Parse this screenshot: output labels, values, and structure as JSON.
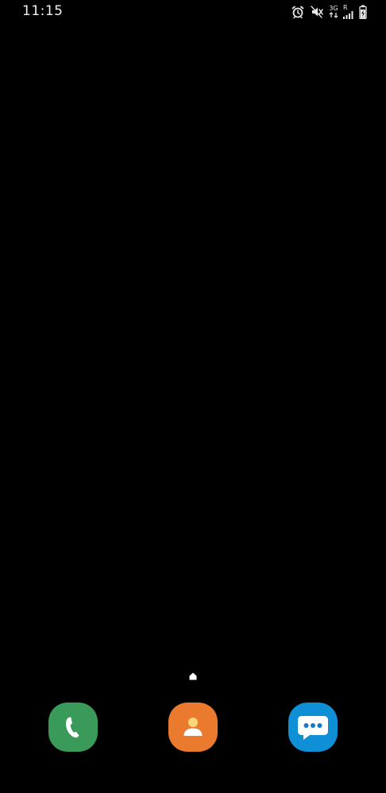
{
  "status_bar": {
    "time": "11:15",
    "network_type": "3G",
    "roaming": "R",
    "icons": [
      "alarm-icon",
      "mute-icon",
      "data-arrows-icon",
      "signal-icon",
      "battery-charging-icon"
    ]
  },
  "home": {
    "page_indicator_icon": "home-icon"
  },
  "dock": {
    "apps": [
      {
        "icon": "phone-icon",
        "color": "#3a9a5a"
      },
      {
        "icon": "contacts-icon",
        "color": "#ea7a2e"
      },
      {
        "icon": "messages-icon",
        "color": "#0f8fd6"
      }
    ]
  },
  "colors": {
    "background": "#000000",
    "status_text": "#f2f2f2"
  }
}
